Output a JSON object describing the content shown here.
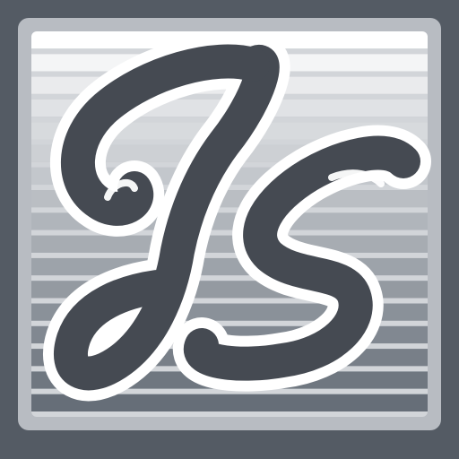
{
  "logo": {
    "monogram": "JS",
    "colors": {
      "background": "#545b64",
      "frame": "#b8bcc2",
      "letter_fill": "#454a52",
      "letter_outline": "#ffffff"
    },
    "stripe_colors": [
      "#ffffff",
      "#f4f5f6",
      "#eaebed",
      "#e0e2e5",
      "#d7dadd",
      "#cdd0d4",
      "#c3c7cc",
      "#babec3",
      "#b0b5bb",
      "#a7acb2",
      "#9da3aa",
      "#949aa1",
      "#8a9199",
      "#818891",
      "#787f88",
      "#6f7780",
      "#666e78"
    ]
  }
}
